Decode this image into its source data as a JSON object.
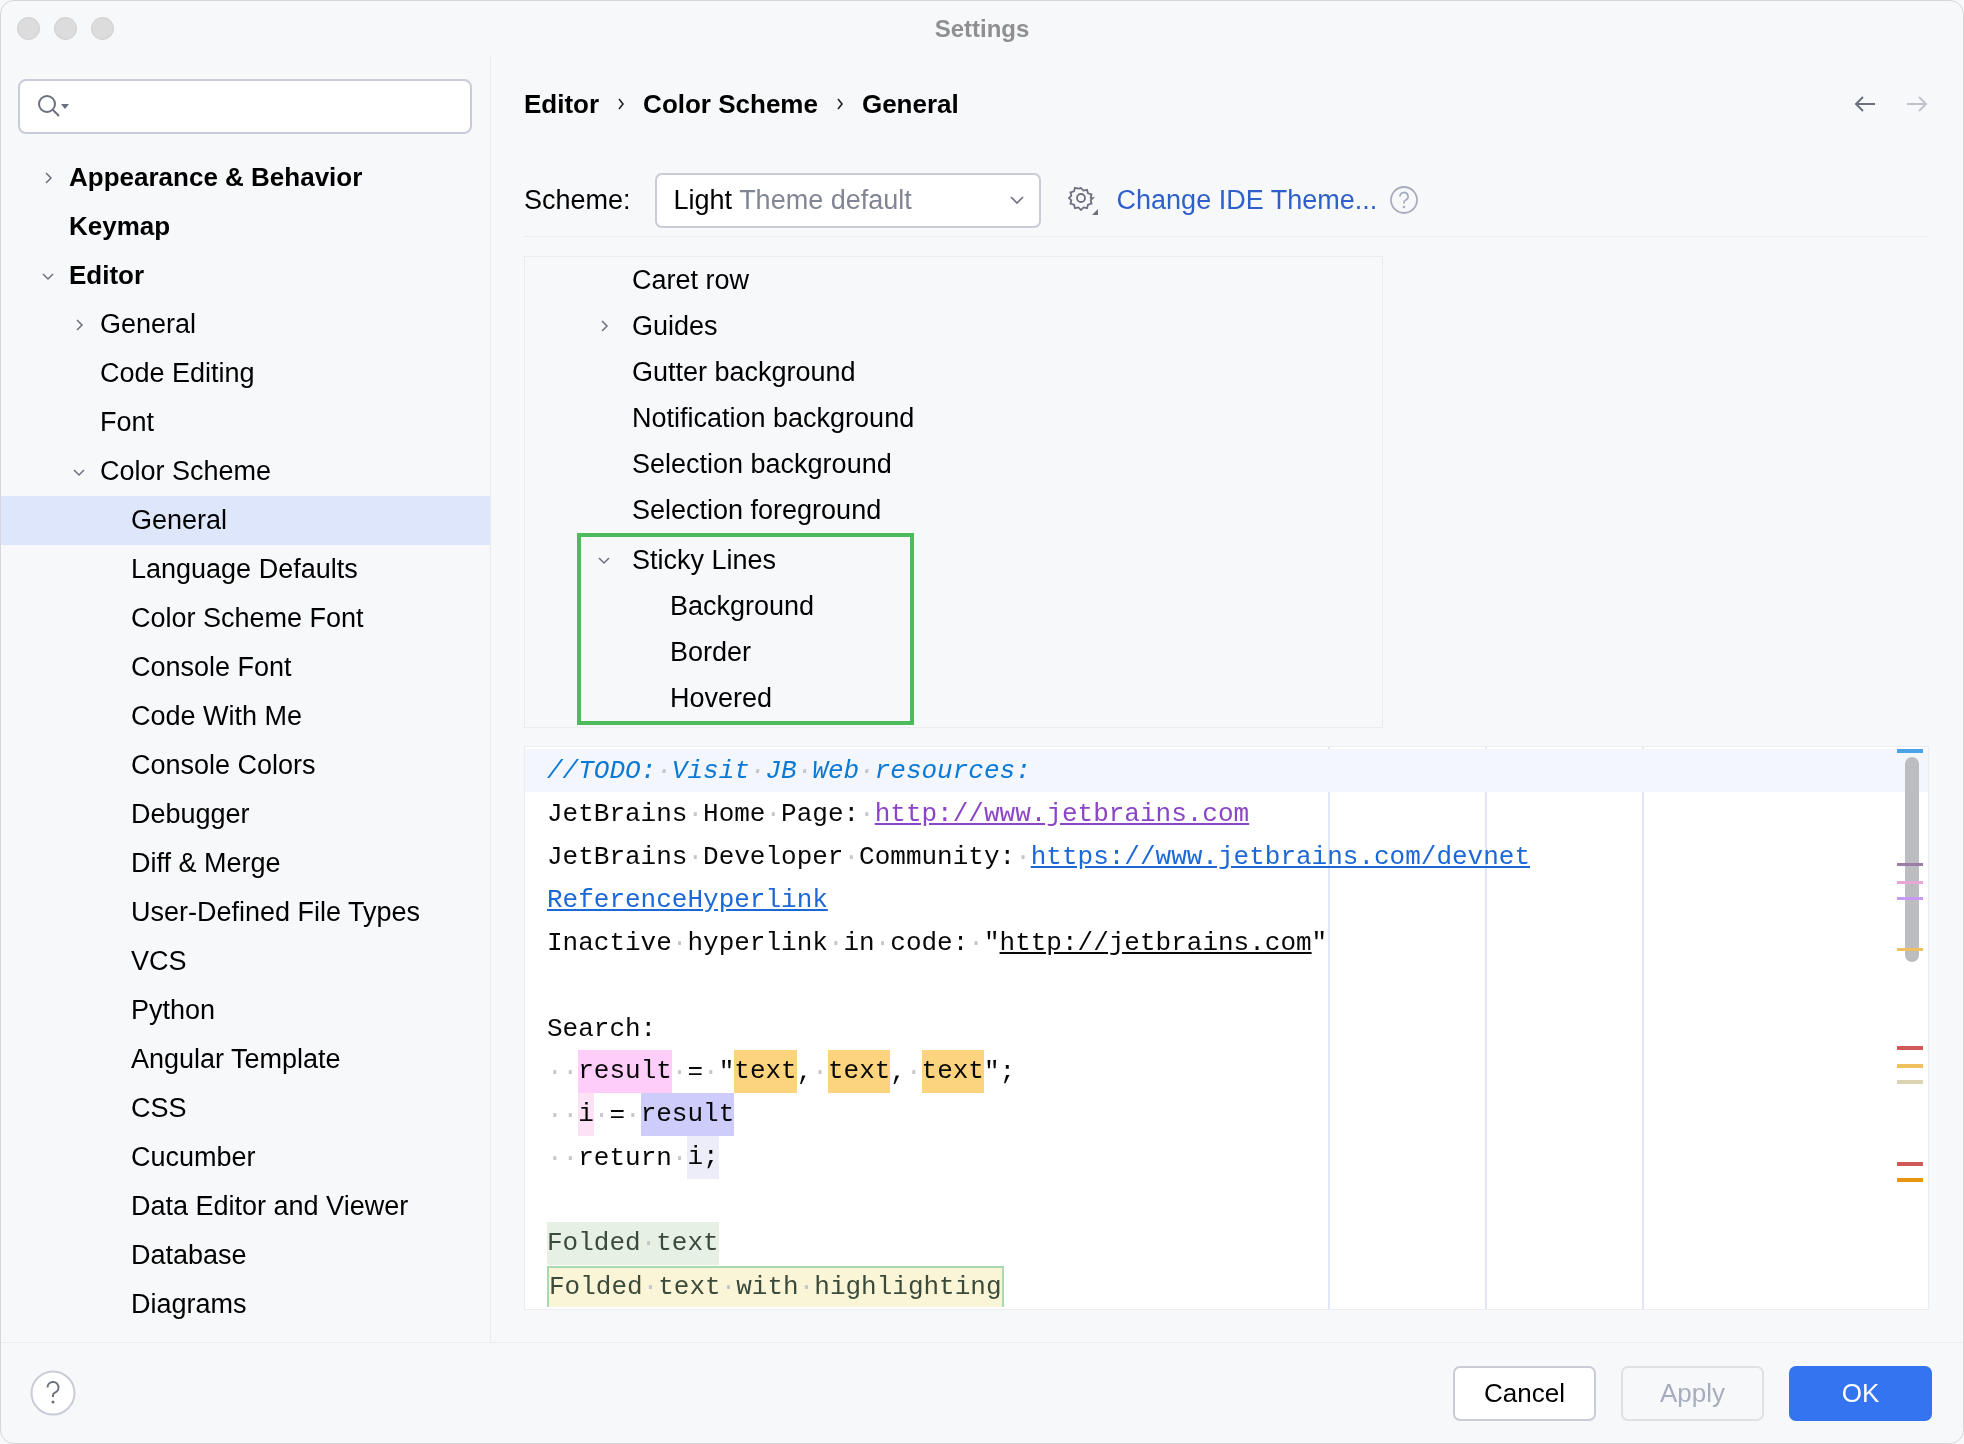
{
  "window": {
    "title": "Settings"
  },
  "sidebar": {
    "items": [
      {
        "label": "Appearance & Behavior",
        "selected": false,
        "expanded": false
      },
      {
        "label": "Keymap",
        "selected": false
      },
      {
        "label": "Editor",
        "selected": false,
        "expanded": true,
        "children": [
          {
            "label": "General",
            "selected": false,
            "expanded": false
          },
          {
            "label": "Code Editing",
            "selected": false
          },
          {
            "label": "Font",
            "selected": false
          },
          {
            "label": "Color Scheme",
            "selected": false,
            "expanded": true,
            "children": [
              {
                "label": "General",
                "selected": true
              },
              {
                "label": "Language Defaults",
                "selected": false
              },
              {
                "label": "Color Scheme Font",
                "selected": false
              },
              {
                "label": "Console Font",
                "selected": false
              },
              {
                "label": "Code With Me",
                "selected": false
              },
              {
                "label": "Console Colors",
                "selected": false
              },
              {
                "label": "Debugger",
                "selected": false
              },
              {
                "label": "Diff & Merge",
                "selected": false
              },
              {
                "label": "User-Defined File Types",
                "selected": false
              },
              {
                "label": "VCS",
                "selected": false
              },
              {
                "label": "Python",
                "selected": false
              },
              {
                "label": "Angular Template",
                "selected": false
              },
              {
                "label": "CSS",
                "selected": false
              },
              {
                "label": "Cucumber",
                "selected": false
              },
              {
                "label": "Data Editor and Viewer",
                "selected": false
              },
              {
                "label": "Database",
                "selected": false
              },
              {
                "label": "Diagrams",
                "selected": false
              }
            ]
          }
        ]
      }
    ]
  },
  "breadcrumb": [
    "Editor",
    "Color Scheme",
    "General"
  ],
  "navigation": [
    {
      "kind": "back",
      "disabled": false
    },
    {
      "kind": "forward",
      "disabled": true
    }
  ],
  "scheme": {
    "label": "Scheme:",
    "value": "Light",
    "hint": "Theme default",
    "link": "Change IDE Theme..."
  },
  "color_tree": {
    "items": [
      {
        "label": "Caret row"
      },
      {
        "label": "Guides",
        "expanded": false
      },
      {
        "label": "Gutter background"
      },
      {
        "label": "Notification background"
      },
      {
        "label": "Selection background"
      },
      {
        "label": "Selection foreground"
      },
      {
        "label": "Sticky Lines",
        "expanded": true,
        "highlighted": true,
        "children": [
          {
            "label": "Background"
          },
          {
            "label": "Border"
          },
          {
            "label": "Hovered"
          }
        ]
      }
    ]
  },
  "preview": {
    "lines": [
      {
        "current": true,
        "segments": [
          {
            "text": "//TODO:·Visit·JB·Web·resources:",
            "kind": "comment"
          }
        ]
      },
      {
        "current": false,
        "segments": [
          {
            "text": "JetBrains·Home·Page:·",
            "kind": "text"
          },
          {
            "text": "http://www.jetbrains.com",
            "kind": "link-visited"
          }
        ]
      },
      {
        "current": false,
        "segments": [
          {
            "text": "JetBrains·Developer·Community:·",
            "kind": "text"
          },
          {
            "text": "https://www.jetbrains.com/devnet",
            "kind": "link"
          }
        ]
      },
      {
        "current": false,
        "segments": [
          {
            "text": "ReferenceHyperlink",
            "kind": "link"
          }
        ]
      },
      {
        "current": false,
        "segments": [
          {
            "text": "Inactive·hyperlink·in·code:·\"",
            "kind": "text"
          },
          {
            "text": "http://jetbrains.com",
            "kind": "link-inactive"
          },
          {
            "text": "\"",
            "kind": "text"
          }
        ]
      },
      {
        "current": false
      },
      {
        "current": false,
        "segments": [
          {
            "text": "Search:",
            "kind": "text"
          }
        ]
      },
      {
        "current": false,
        "segments": [
          {
            "text": "··",
            "kind": "text"
          },
          {
            "text": "result",
            "kind": "write-match"
          },
          {
            "text": "·=·\"",
            "kind": "text"
          },
          {
            "text": "text",
            "kind": "search-match"
          },
          {
            "text": ",·",
            "kind": "text"
          },
          {
            "text": "text",
            "kind": "search-match"
          },
          {
            "text": ",·",
            "kind": "text"
          },
          {
            "text": "text",
            "kind": "search-match"
          },
          {
            "text": "\";",
            "kind": "text"
          }
        ]
      },
      {
        "current": false,
        "segments": [
          {
            "text": "··",
            "kind": "text"
          },
          {
            "text": "i",
            "kind": "write-usage"
          },
          {
            "text": "·=·",
            "kind": "text"
          },
          {
            "text": "result",
            "kind": "read-match"
          }
        ]
      },
      {
        "current": false,
        "segments": [
          {
            "text": "··return·",
            "kind": "text"
          },
          {
            "text": "i;",
            "kind": "usage"
          }
        ]
      },
      {
        "current": false
      },
      {
        "current": false,
        "segments": [
          {
            "text": "Folded·text",
            "kind": "folded"
          }
        ]
      },
      {
        "current": false,
        "segments": [
          {
            "text": "Folded·text·with·highlighting",
            "kind": "folded-highlighted"
          }
        ]
      }
    ]
  },
  "buttons": [
    {
      "label": "Cancel",
      "kind": "default",
      "disabled": false
    },
    {
      "label": "Apply",
      "kind": "default",
      "disabled": true
    },
    {
      "label": "OK",
      "kind": "primary",
      "disabled": false
    }
  ]
}
